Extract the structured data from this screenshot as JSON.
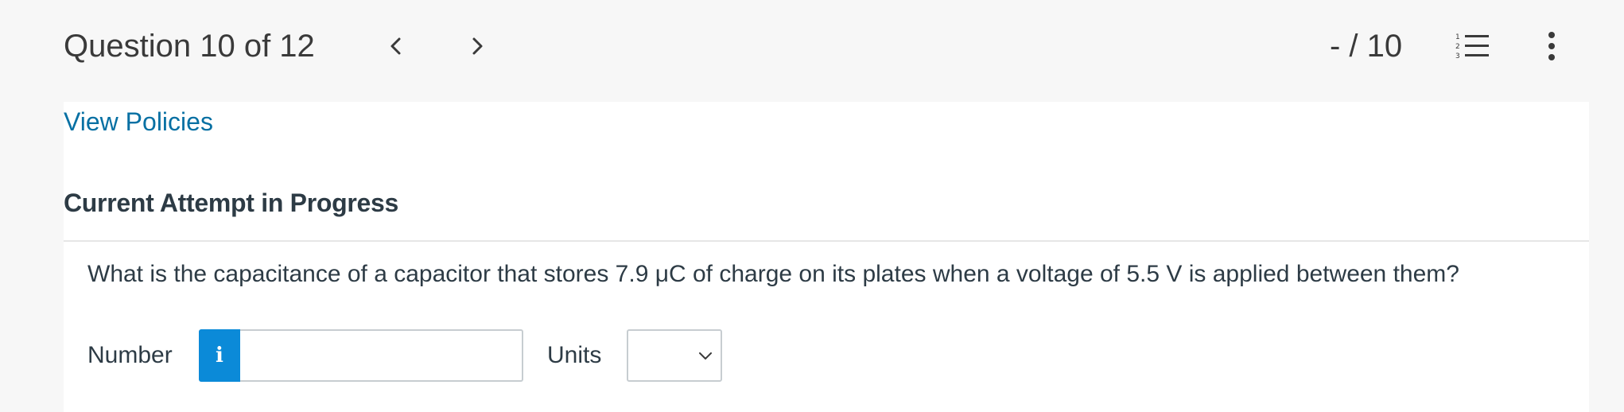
{
  "header": {
    "question_position": "Question 10 of 12",
    "score": "- / 10",
    "icons": {
      "prev": "chevron-left-icon",
      "next": "chevron-right-icon",
      "question_list": "numbered-list-icon",
      "more": "more-vertical-icon"
    }
  },
  "content": {
    "view_policies_link": "View Policies",
    "attempt_heading": "Current Attempt in Progress",
    "question_text": "What is the capacitance of a capacitor that stores 7.9 μC of charge on its plates when a voltage of 5.5 V is applied between them?",
    "answer": {
      "number_label": "Number",
      "info_icon": "info-icon",
      "info_glyph": "i",
      "number_value": "",
      "units_label": "Units",
      "units_selected": ""
    }
  },
  "colors": {
    "link": "#0770a3",
    "info_button": "#0b8ad8",
    "page_background": "#f7f7f7",
    "panel_background": "#ffffff"
  }
}
